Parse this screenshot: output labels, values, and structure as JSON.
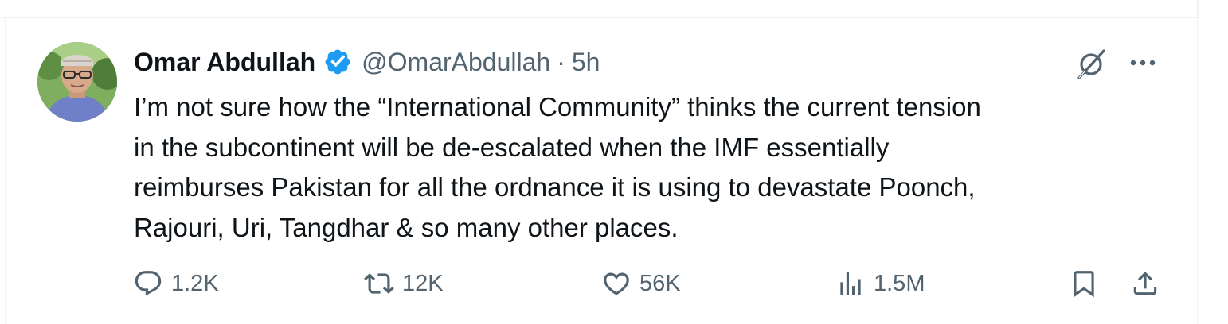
{
  "tweet": {
    "author_name": "Omar Abdullah",
    "handle": "@OmarAbdullah",
    "separator": "·",
    "time": "5h",
    "text_lines": [
      "I’m not sure how the “International Community” thinks the current tension",
      "in the subcontinent will be de-escalated when the IMF essentially",
      "reimburses Pakistan for all the ordnance it is using to devastate Poonch,",
      "Rajouri, Uri, Tangdhar & so many other places."
    ]
  },
  "icons": {
    "verified": "verified-badge-icon",
    "grok": "grok-icon",
    "more": "more-icon",
    "reply": "reply-icon",
    "repost": "repost-icon",
    "like": "like-icon",
    "views": "views-icon",
    "bookmark": "bookmark-icon",
    "share": "share-icon"
  },
  "metrics": {
    "replies": "1.2K",
    "reposts": "12K",
    "likes": "56K",
    "views": "1.5M"
  },
  "colors": {
    "verified_blue": "#1d9bf0",
    "text_primary": "#0f1419",
    "text_secondary": "#536471",
    "border": "#eff3f4"
  }
}
